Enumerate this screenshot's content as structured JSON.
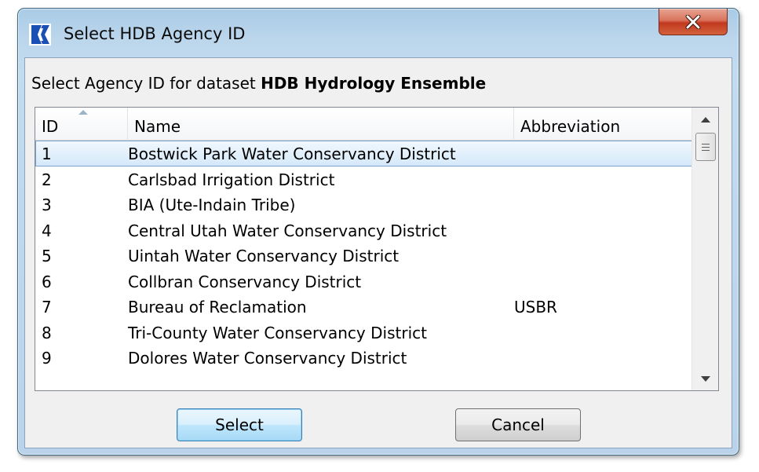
{
  "window": {
    "title": "Select HDB Agency ID"
  },
  "prompt": {
    "prefix": "Select Agency ID for dataset ",
    "dataset": "HDB Hydrology Ensemble"
  },
  "table": {
    "columns": [
      "ID",
      "Name",
      "Abbreviation"
    ],
    "sort_column": "ID",
    "sort_direction": "ascending",
    "selected_id": "1",
    "rows": [
      {
        "id": "1",
        "name": "Bostwick Park Water Conservancy District",
        "abbr": ""
      },
      {
        "id": "2",
        "name": "Carlsbad Irrigation District",
        "abbr": ""
      },
      {
        "id": "3",
        "name": "BIA (Ute-Indain Tribe)",
        "abbr": ""
      },
      {
        "id": "4",
        "name": "Central Utah Water Conservancy District",
        "abbr": ""
      },
      {
        "id": "5",
        "name": "Uintah Water Conservancy District",
        "abbr": ""
      },
      {
        "id": "6",
        "name": "Collbran Conservancy District",
        "abbr": ""
      },
      {
        "id": "7",
        "name": "Bureau of Reclamation",
        "abbr": "USBR"
      },
      {
        "id": "8",
        "name": "Tri-County Water Conservancy District",
        "abbr": ""
      },
      {
        "id": "9",
        "name": "Dolores Water Conservancy District",
        "abbr": ""
      }
    ]
  },
  "buttons": {
    "select": "Select",
    "cancel": "Cancel"
  },
  "icons": {
    "app": "riverware-r-icon",
    "close": "close-x-icon",
    "sort": "sort-ascending-icon",
    "scroll_up": "scroll-up-arrow-icon",
    "scroll_down": "scroll-down-arrow-icon"
  },
  "colors": {
    "titlebar": "#bcd6ec",
    "close_button": "#c2391f",
    "selection": "#d4e8f9",
    "default_button": "#bee6fd"
  }
}
